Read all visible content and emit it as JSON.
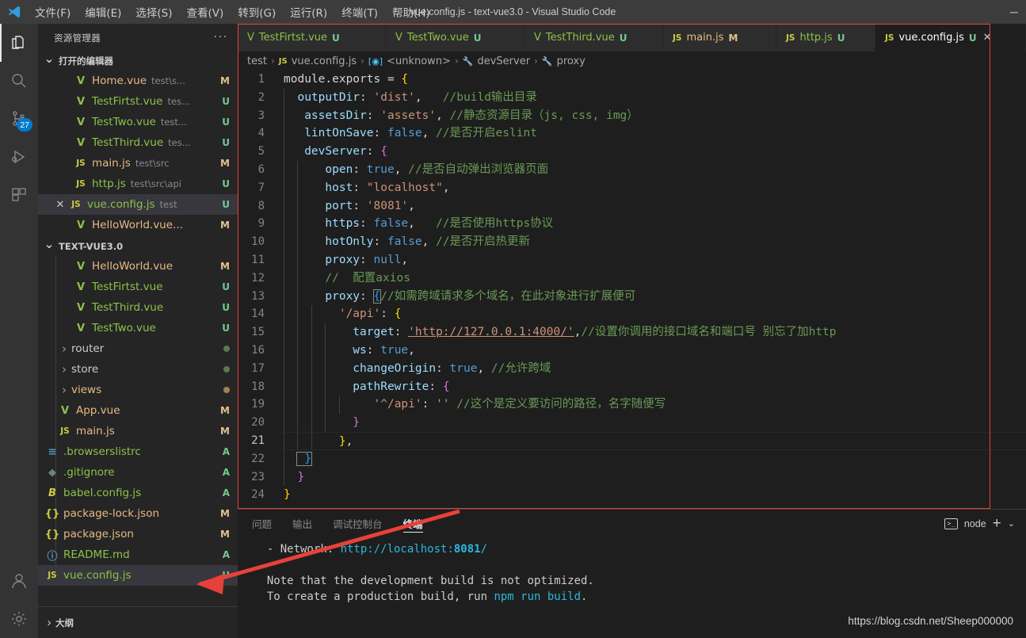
{
  "titlebar": {
    "menu": [
      "文件(F)",
      "编辑(E)",
      "选择(S)",
      "查看(V)",
      "转到(G)",
      "运行(R)",
      "终端(T)",
      "帮助(H)"
    ],
    "title": "vue.config.js - text-vue3.0 - Visual Studio Code",
    "minimize": "─",
    "logo_name": "vscode-logo"
  },
  "activitybar": {
    "items": [
      {
        "name": "explorer-icon",
        "badge": ""
      },
      {
        "name": "search-icon",
        "badge": ""
      },
      {
        "name": "source-control-icon",
        "badge": "27"
      },
      {
        "name": "run-debug-icon",
        "badge": ""
      },
      {
        "name": "extensions-icon",
        "badge": ""
      }
    ],
    "bottom": [
      {
        "name": "account-icon"
      },
      {
        "name": "settings-gear-icon"
      }
    ]
  },
  "sidebar": {
    "header": "资源管理器",
    "more_actions": "···",
    "open_editors": {
      "title": "打开的编辑器",
      "items": [
        {
          "icon": "vue",
          "name": "Home.vue",
          "path": "test\\s...",
          "status": "M",
          "selected": false,
          "closable": false
        },
        {
          "icon": "vue",
          "name": "TestFirtst.vue",
          "path": "tes...",
          "status": "U",
          "selected": false,
          "closable": false
        },
        {
          "icon": "vue",
          "name": "TestTwo.vue",
          "path": "test...",
          "status": "U",
          "selected": false,
          "closable": false
        },
        {
          "icon": "vue",
          "name": "TestThird.vue",
          "path": "tes...",
          "status": "U",
          "selected": false,
          "closable": false
        },
        {
          "icon": "js",
          "name": "main.js",
          "path": "test\\src",
          "status": "M",
          "selected": false,
          "closable": false
        },
        {
          "icon": "js",
          "name": "http.js",
          "path": "test\\src\\api",
          "status": "U",
          "selected": false,
          "closable": false
        },
        {
          "icon": "js",
          "name": "vue.config.js",
          "path": "test",
          "status": "U",
          "selected": true,
          "closable": true
        },
        {
          "icon": "vue",
          "name": "HelloWorld.vue...",
          "path": "",
          "status": "M",
          "selected": false,
          "closable": false
        }
      ]
    },
    "project": {
      "title": "TEXT-VUE3.0",
      "items": [
        {
          "icon": "vue",
          "name": "HelloWorld.vue",
          "status": "M",
          "indent": 3
        },
        {
          "icon": "vue",
          "name": "TestFirtst.vue",
          "status": "U",
          "indent": 3
        },
        {
          "icon": "vue",
          "name": "TestThird.vue",
          "status": "U",
          "indent": 3
        },
        {
          "icon": "vue",
          "name": "TestTwo.vue",
          "status": "U",
          "indent": 3
        },
        {
          "icon": "folder",
          "name": "router",
          "status": "dot-green",
          "indent": 2
        },
        {
          "icon": "folder",
          "name": "store",
          "status": "dot-green",
          "indent": 2
        },
        {
          "icon": "folder",
          "name": "views",
          "status": "dot-orange",
          "indent": 2
        },
        {
          "icon": "vue",
          "name": "App.vue",
          "status": "M",
          "indent": 2
        },
        {
          "icon": "js",
          "name": "main.js",
          "status": "M",
          "indent": 2
        },
        {
          "icon": "list",
          "name": ".browserslistrc",
          "status": "A",
          "indent": 1
        },
        {
          "icon": "git",
          "name": ".gitignore",
          "status": "A",
          "indent": 1
        },
        {
          "icon": "babel",
          "name": "babel.config.js",
          "status": "A",
          "indent": 1
        },
        {
          "icon": "json",
          "name": "package-lock.json",
          "status": "M",
          "indent": 1
        },
        {
          "icon": "json",
          "name": "package.json",
          "status": "M",
          "indent": 1
        },
        {
          "icon": "md",
          "name": "README.md",
          "status": "A",
          "indent": 1
        },
        {
          "icon": "js",
          "name": "vue.config.js",
          "status": "U",
          "indent": 1,
          "selected": true
        }
      ]
    },
    "outline": "大纲"
  },
  "editor": {
    "tabs": [
      {
        "icon": "vue",
        "label": "TestFirtst.vue",
        "status": "U",
        "active": false
      },
      {
        "icon": "vue",
        "label": "TestTwo.vue",
        "status": "U",
        "active": false
      },
      {
        "icon": "vue",
        "label": "TestThird.vue",
        "status": "U",
        "active": false
      },
      {
        "icon": "js",
        "label": "main.js",
        "status": "M",
        "active": false
      },
      {
        "icon": "js",
        "label": "http.js",
        "status": "U",
        "active": false
      },
      {
        "icon": "js",
        "label": "vue.config.js",
        "status": "U",
        "active": true,
        "close": "✕"
      }
    ],
    "breadcrumb": [
      {
        "icon": "",
        "label": "test"
      },
      {
        "icon": "js",
        "label": "vue.config.js"
      },
      {
        "icon": "obj",
        "label": "<unknown>"
      },
      {
        "icon": "prop",
        "label": "devServer"
      },
      {
        "icon": "prop",
        "label": "proxy"
      }
    ],
    "breadcrumb_sep": "›",
    "current_line": 21,
    "code": [
      {
        "n": 1,
        "segments": [
          {
            "t": "module.exports ",
            "c": "tk-pl"
          },
          {
            "t": "= ",
            "c": "tk-op"
          },
          {
            "t": "{",
            "c": "br-y"
          }
        ]
      },
      {
        "n": 2,
        "indent": 1,
        "segments": [
          {
            "t": "outputDir",
            "c": "tk-prop"
          },
          {
            "t": ": ",
            "c": "tk-op"
          },
          {
            "t": "'dist'",
            "c": "tk-str"
          },
          {
            "t": ",   ",
            "c": "tk-op"
          },
          {
            "t": "//build输出目录",
            "c": "tk-com"
          }
        ]
      },
      {
        "n": 3,
        "indent": 1,
        "segments": [
          {
            "t": " assetsDir",
            "c": "tk-prop"
          },
          {
            "t": ": ",
            "c": "tk-op"
          },
          {
            "t": "'assets'",
            "c": "tk-str"
          },
          {
            "t": ", ",
            "c": "tk-op"
          },
          {
            "t": "//静态资源目录（js, css, img）",
            "c": "tk-com"
          }
        ]
      },
      {
        "n": 4,
        "indent": 1,
        "segments": [
          {
            "t": " lintOnSave",
            "c": "tk-prop"
          },
          {
            "t": ": ",
            "c": "tk-op"
          },
          {
            "t": "false",
            "c": "tk-kw"
          },
          {
            "t": ", ",
            "c": "tk-op"
          },
          {
            "t": "//是否开启eslint",
            "c": "tk-com"
          }
        ]
      },
      {
        "n": 5,
        "indent": 1,
        "segments": [
          {
            "t": " devServer",
            "c": "tk-prop"
          },
          {
            "t": ": ",
            "c": "tk-op"
          },
          {
            "t": "{",
            "c": "br-p"
          }
        ]
      },
      {
        "n": 6,
        "indent": 2,
        "segments": [
          {
            "t": "  open",
            "c": "tk-prop"
          },
          {
            "t": ": ",
            "c": "tk-op"
          },
          {
            "t": "true",
            "c": "tk-kw"
          },
          {
            "t": ", ",
            "c": "tk-op"
          },
          {
            "t": "//是否自动弹出浏览器页面",
            "c": "tk-com"
          }
        ]
      },
      {
        "n": 7,
        "indent": 2,
        "segments": [
          {
            "t": "  host",
            "c": "tk-prop"
          },
          {
            "t": ": ",
            "c": "tk-op"
          },
          {
            "t": "\"localhost\"",
            "c": "tk-str"
          },
          {
            "t": ",",
            "c": "tk-op"
          }
        ]
      },
      {
        "n": 8,
        "indent": 2,
        "segments": [
          {
            "t": "  port",
            "c": "tk-prop"
          },
          {
            "t": ": ",
            "c": "tk-op"
          },
          {
            "t": "'8081'",
            "c": "tk-str"
          },
          {
            "t": ",",
            "c": "tk-op"
          }
        ]
      },
      {
        "n": 9,
        "indent": 2,
        "segments": [
          {
            "t": "  https",
            "c": "tk-prop"
          },
          {
            "t": ": ",
            "c": "tk-op"
          },
          {
            "t": "false",
            "c": "tk-kw"
          },
          {
            "t": ",   ",
            "c": "tk-op"
          },
          {
            "t": "//是否使用https协议",
            "c": "tk-com"
          }
        ]
      },
      {
        "n": 10,
        "indent": 2,
        "segments": [
          {
            "t": "  hotOnly",
            "c": "tk-prop"
          },
          {
            "t": ": ",
            "c": "tk-op"
          },
          {
            "t": "false",
            "c": "tk-kw"
          },
          {
            "t": ", ",
            "c": "tk-op"
          },
          {
            "t": "//是否开启热更新",
            "c": "tk-com"
          }
        ]
      },
      {
        "n": 11,
        "indent": 2,
        "segments": [
          {
            "t": "  proxy",
            "c": "tk-prop"
          },
          {
            "t": ": ",
            "c": "tk-op"
          },
          {
            "t": "null",
            "c": "tk-kw"
          },
          {
            "t": ",",
            "c": "tk-op"
          }
        ]
      },
      {
        "n": 12,
        "indent": 2,
        "segments": [
          {
            "t": "  //  配置axios",
            "c": "tk-com"
          }
        ]
      },
      {
        "n": 13,
        "indent": 2,
        "segments": [
          {
            "t": "  proxy",
            "c": "tk-prop"
          },
          {
            "t": ": ",
            "c": "tk-op"
          },
          {
            "t": "{",
            "c": "br-b bracket-box"
          },
          {
            "t": "//如需跨域请求多个域名，在此对象进行扩展便可",
            "c": "tk-com"
          }
        ]
      },
      {
        "n": 14,
        "indent": 3,
        "segments": [
          {
            "t": "  '/api'",
            "c": "tk-str"
          },
          {
            "t": ": ",
            "c": "tk-op"
          },
          {
            "t": "{",
            "c": "br-y"
          }
        ]
      },
      {
        "n": 15,
        "indent": 4,
        "segments": [
          {
            "t": "  target",
            "c": "tk-prop"
          },
          {
            "t": ": ",
            "c": "tk-op"
          },
          {
            "t": "'http://127.0.0.1:4000/'",
            "c": "tk-str url-ul"
          },
          {
            "t": ",",
            "c": "tk-op"
          },
          {
            "t": "//设置你调用的接口域名和端口号 别忘了加http",
            "c": "tk-com"
          }
        ]
      },
      {
        "n": 16,
        "indent": 4,
        "segments": [
          {
            "t": "  ws",
            "c": "tk-prop"
          },
          {
            "t": ": ",
            "c": "tk-op"
          },
          {
            "t": "true",
            "c": "tk-kw"
          },
          {
            "t": ",",
            "c": "tk-op"
          }
        ]
      },
      {
        "n": 17,
        "indent": 4,
        "segments": [
          {
            "t": "  changeOrigin",
            "c": "tk-prop"
          },
          {
            "t": ": ",
            "c": "tk-op"
          },
          {
            "t": "true",
            "c": "tk-kw"
          },
          {
            "t": ", ",
            "c": "tk-op"
          },
          {
            "t": "//允许跨域",
            "c": "tk-com"
          }
        ]
      },
      {
        "n": 18,
        "indent": 4,
        "segments": [
          {
            "t": "  pathRewrite",
            "c": "tk-prop"
          },
          {
            "t": ": ",
            "c": "tk-op"
          },
          {
            "t": "{",
            "c": "br-p"
          }
        ]
      },
      {
        "n": 19,
        "indent": 5,
        "segments": [
          {
            "t": "   '^/api'",
            "c": "tk-str"
          },
          {
            "t": ": ",
            "c": "tk-op"
          },
          {
            "t": "''",
            "c": "tk-str"
          },
          {
            "t": " ",
            "c": "tk-op"
          },
          {
            "t": "//这个是定义要访问的路径，名字随便写",
            "c": "tk-com"
          }
        ]
      },
      {
        "n": 20,
        "indent": 4,
        "segments": [
          {
            "t": "  }",
            "c": "br-p"
          }
        ]
      },
      {
        "n": 21,
        "indent": 3,
        "segments": [
          {
            "t": "  }",
            "c": "br-y"
          },
          {
            "t": ",",
            "c": "tk-op"
          }
        ]
      },
      {
        "n": 22,
        "indent": 1,
        "segments": [
          {
            "t": " }",
            "c": "br-b bracket-box"
          }
        ]
      },
      {
        "n": 23,
        "indent": 1,
        "segments": [
          {
            "t": "}",
            "c": "br-p"
          }
        ]
      },
      {
        "n": 24,
        "segments": [
          {
            "t": "}",
            "c": "br-y"
          }
        ]
      }
    ]
  },
  "panel": {
    "tabs": [
      "问题",
      "输出",
      "调试控制台",
      "终端"
    ],
    "active_tab": "终端",
    "terminal_selector": "node",
    "new_terminal": "+",
    "dropdown": "⌄",
    "terminal_lines": [
      [
        {
          "t": "  - Network: ",
          "c": ""
        },
        {
          "t": "http://localhost:",
          "c": "t-cyan"
        },
        {
          "t": "8081",
          "c": "t-cyanb"
        },
        {
          "t": "/",
          "c": "t-cyan"
        }
      ],
      [
        {
          "t": "",
          "c": ""
        }
      ],
      [
        {
          "t": "  Note that the development build is not optimized.",
          "c": ""
        }
      ],
      [
        {
          "t": "  To create a production build, run ",
          "c": ""
        },
        {
          "t": "npm run build",
          "c": "t-cyan"
        },
        {
          "t": ".",
          "c": ""
        }
      ]
    ]
  },
  "watermark": "https://blog.csdn.net/Sheep000000"
}
